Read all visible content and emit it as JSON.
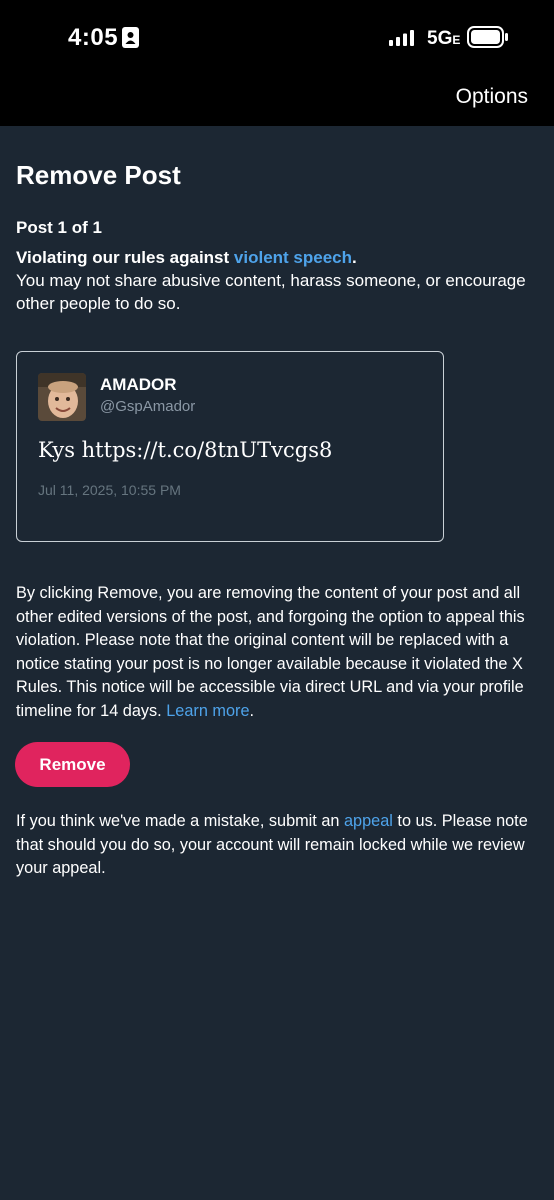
{
  "status_bar": {
    "time": "4:05",
    "network": "5G",
    "network_suffix": "E",
    "icons": [
      "id-badge-icon",
      "signal-icon",
      "battery-icon"
    ]
  },
  "header": {
    "options_label": "Options"
  },
  "page": {
    "title": "Remove Post",
    "post_count": "Post 1 of 1",
    "rule_prefix": "Violating our rules against ",
    "rule_link": "violent speech",
    "rule_suffix": ".",
    "rule_description": "You may not share abusive content, harass someone, or encourage other people to do so."
  },
  "post": {
    "author_name": "AMADOR",
    "author_handle": "@GspAmador",
    "text": "Kys https://t.co/8tnUTvcgs8",
    "date": "Jul 11, 2025, 10:55 PM"
  },
  "disclaimer": {
    "text": "By clicking Remove, you are removing the content of your post and all other edited versions of the post, and forgoing the option to appeal this violation. Please note that the original content will be replaced with a notice stating your post is no longer available because it violated the X Rules. This notice will be accessible via direct URL and via your profile timeline for 14 days. ",
    "link": "Learn more",
    "suffix": "."
  },
  "actions": {
    "remove_label": "Remove"
  },
  "appeal": {
    "prefix": "If you think we've made a mistake, submit an ",
    "link": "appeal",
    "suffix": " to us. Please note that should you do so, your account will remain locked while we review your appeal."
  },
  "colors": {
    "background": "#1c2733",
    "link": "#4ea3ea",
    "remove_button": "#e0245e",
    "status_bar": "#000000"
  }
}
